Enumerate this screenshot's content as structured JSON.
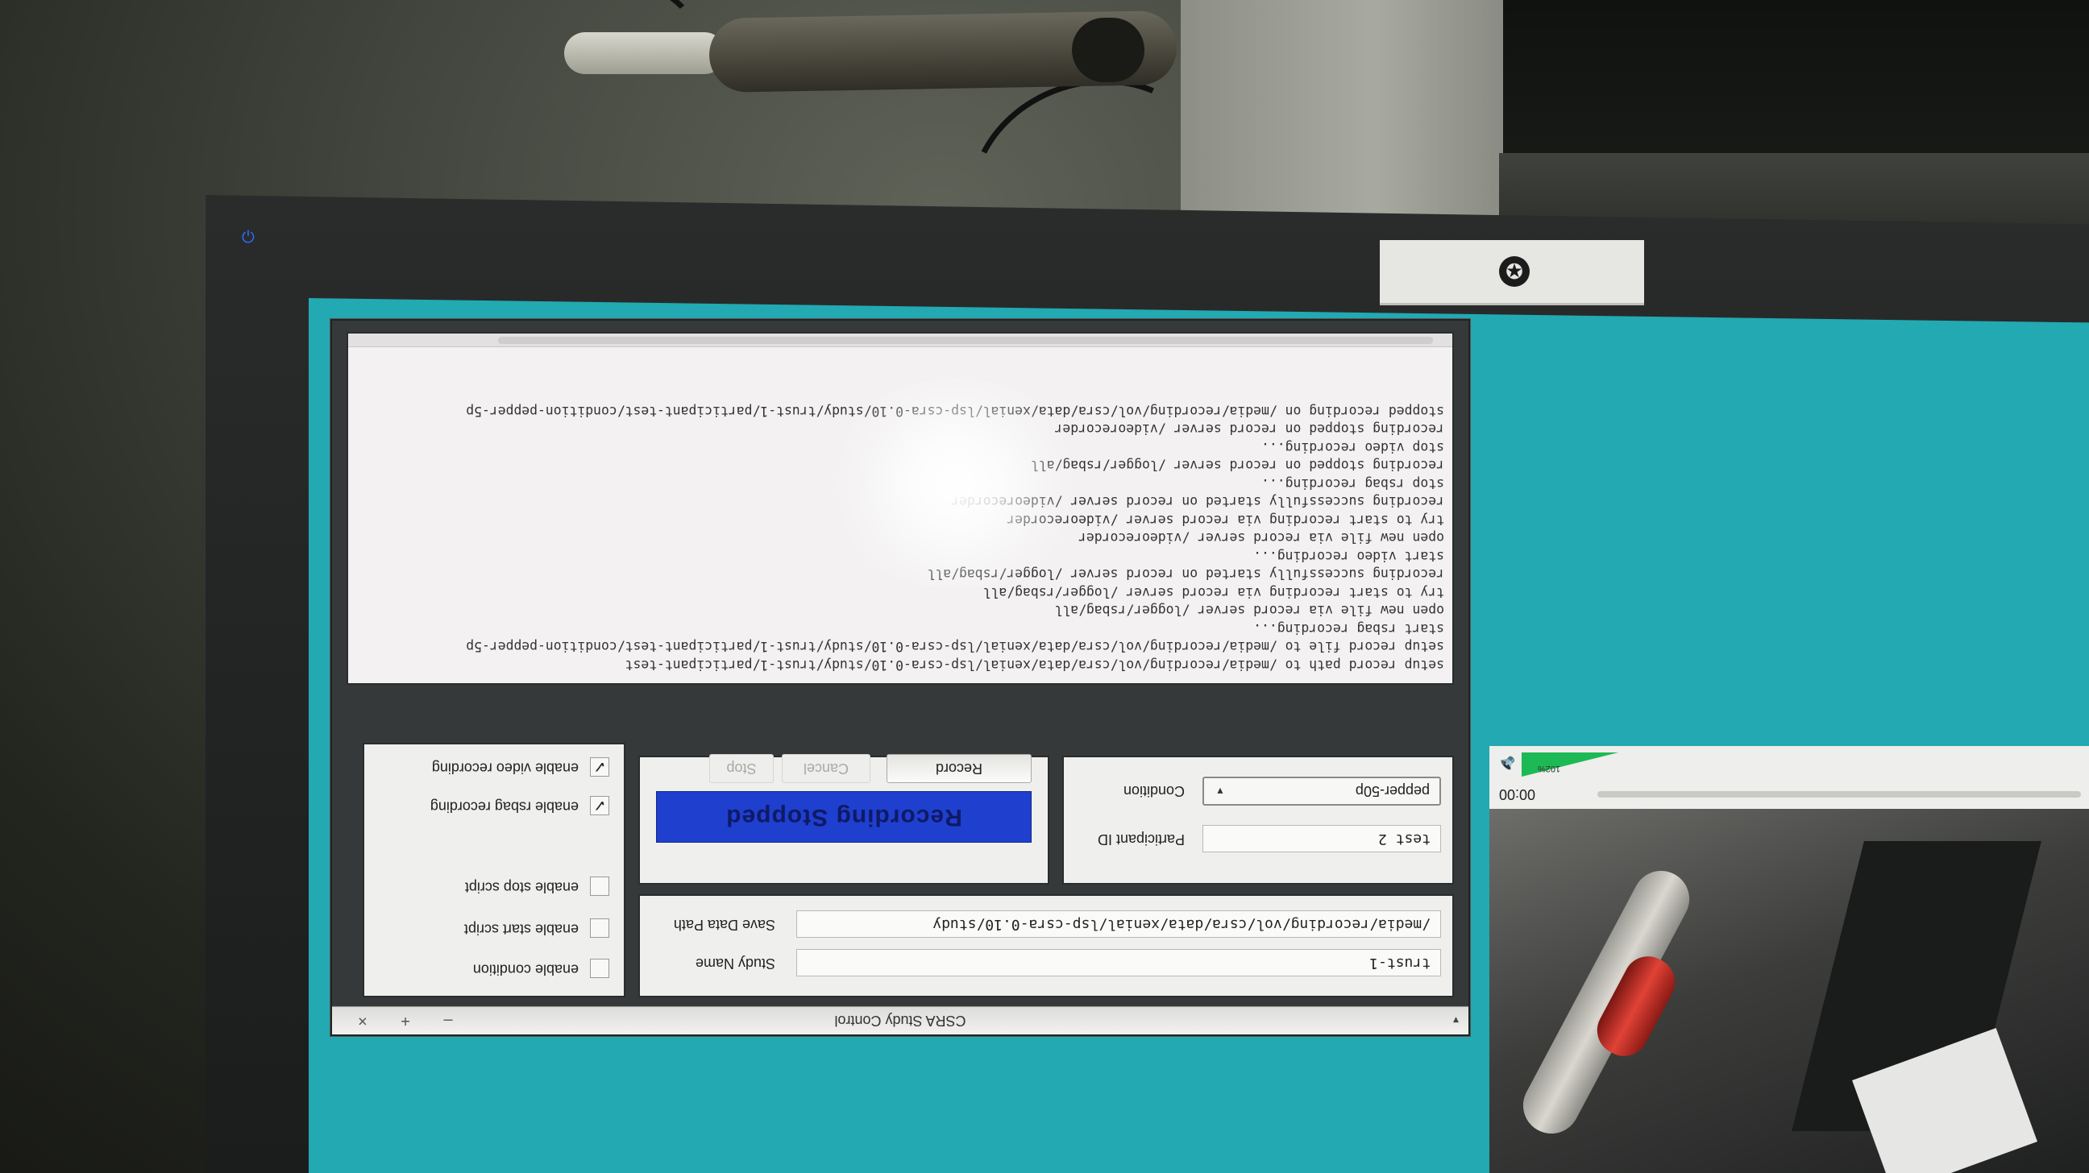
{
  "window": {
    "title": "CSRA Study Control",
    "menu_arrow": "▾",
    "controls": "– + ×"
  },
  "study": {
    "name_value": "trust-1",
    "name_label": "Study Name",
    "path_value": "/media/recording/vol/csra/data/xenial/lsp-csra-0.10/study",
    "path_label": "Save Data Path"
  },
  "participant": {
    "id_value": "test 2",
    "id_label": "Participant ID",
    "condition_value": "pepper-50p",
    "condition_label": "Condition"
  },
  "recording": {
    "status": "Recording Stopped",
    "status_color": "#1f3fcf",
    "record_label": "Record",
    "cancel_label": "Cancel",
    "stop_label": "Stop"
  },
  "options": [
    {
      "label": "enable video recording",
      "checked": true
    },
    {
      "label": "enable rsbag recording",
      "checked": true
    },
    {
      "label": "enable stop script",
      "checked": false
    },
    {
      "label": "enable start script",
      "checked": false
    },
    {
      "label": "enable condition",
      "checked": false
    }
  ],
  "log": [
    "setup record path to /media/recording/vol/csra/data/xenial/lsp-csra-0.10/study/trust-1/participant-test",
    "setup record file to /media/recording/vol/csra/data/xenial/lsp-csra-0.10/study/trust-1/participant-test/condition-pepper-5p",
    "start rsbag recording...",
    "open new file via record server /logger/rsbag/all",
    "try to start recording via record server /logger/rsbag/all",
    "recording successfully started on record server /logger/rsbag/all",
    "start video recording...",
    "open new file via record server /videorecorder",
    "try to start recording via record server /videorecorder",
    "recording successfully started on record server /videorecorder",
    "stop rsbag recording...",
    "recording stopped on record server /logger/rsbag/all",
    "stop video recording...",
    "recording stopped on record server /videorecorder",
    "stopped recording on /media/recording/vol/csra/data/xenial/lsp-csra-0.10/study/trust-1/participant-test/condition-pepper-5p"
  ],
  "player": {
    "time": "00:00",
    "volume_label": "102%",
    "volume_level": 1.02,
    "volume_color": "#1db954"
  },
  "icons": {
    "monitor_power": "power-icon",
    "panel": "steering-wheel-icon",
    "speaker": "speaker-icon"
  }
}
